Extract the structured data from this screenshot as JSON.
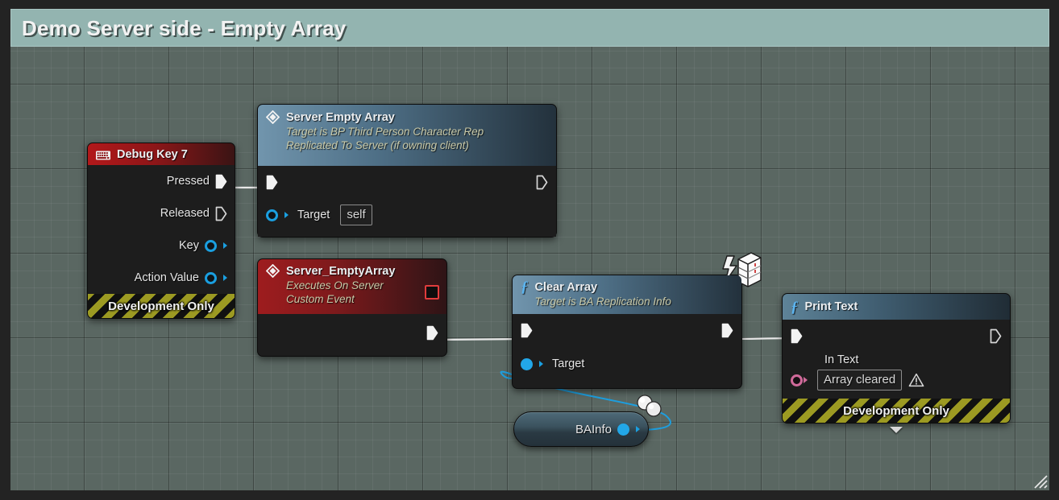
{
  "comment": {
    "title": "Demo Server side - Empty Array",
    "color": "#93b4b0"
  },
  "canvas": {
    "background_color": "#5a6762",
    "grid": "on"
  },
  "nodes": {
    "debug_key": {
      "title": "Debug Key 7",
      "icon": "keyboard-icon",
      "header_color": "#b2181a",
      "pins": [
        {
          "label": "Pressed",
          "type": "exec",
          "connected": true
        },
        {
          "label": "Released",
          "type": "exec",
          "connected": false
        },
        {
          "label": "Key",
          "type": "object",
          "connected": false
        },
        {
          "label": "Action Value",
          "type": "object",
          "connected": false
        }
      ],
      "footer": "Development Only"
    },
    "server_empty_array": {
      "title": "Server Empty Array",
      "subtitle_line1": "Target is BP Third Person Character Rep",
      "subtitle_line2": "Replicated To Server (if owning client)",
      "icon": "diamond-event-icon",
      "header_color": "#4e6f86",
      "exec_in": true,
      "exec_out": false,
      "target_label": "Target",
      "target_value": "self"
    },
    "custom_event": {
      "title": "Server_EmptyArray",
      "subtitle_line1": "Executes On Server",
      "subtitle_line2": "Custom Event",
      "icon": "diamond-event-icon",
      "header_color": "#9e1c1e",
      "badge": "red-square-icon",
      "exec_out": true
    },
    "clear_array": {
      "title": "Clear Array",
      "subtitle_line1": "Target is BA Replication Info",
      "icon": "function-icon",
      "header_color": "#4e6f86",
      "badge": "server-replicated-icon",
      "exec_in": true,
      "exec_out": true,
      "target_label": "Target"
    },
    "print_text": {
      "title": "Print Text",
      "icon": "function-icon",
      "header_color": "#3e5b6e",
      "exec_in": true,
      "exec_out": false,
      "in_text_label": "In Text",
      "in_text_value": "Array cleared",
      "warning": "warning-icon",
      "footer": "Development Only",
      "expand": "chevron-down-icon"
    },
    "bainfo": {
      "label": "BAInfo",
      "type": "object-reference",
      "badge": "replicated-variable-icon",
      "pin_color": "#22a7e8"
    }
  },
  "wires": {
    "exec_color": "#e8e8e8",
    "object_color": "#1a9fe0"
  },
  "resize_grip": "resize-grip-icon"
}
